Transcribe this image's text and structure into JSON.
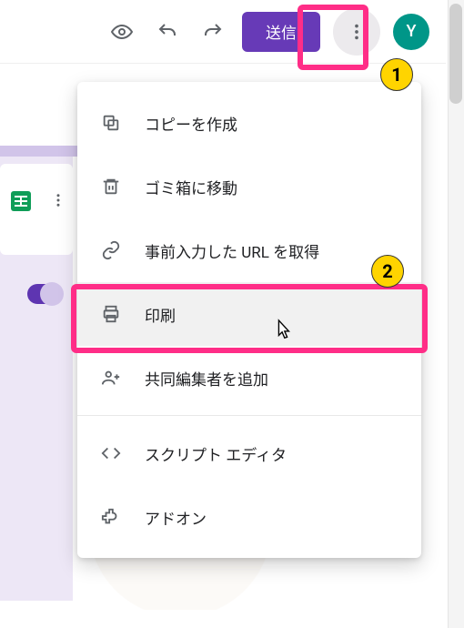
{
  "header": {
    "send_label": "送信",
    "avatar_initial": "Y"
  },
  "menu": {
    "items": [
      {
        "icon": "copy-icon",
        "label": "コピーを作成"
      },
      {
        "icon": "trash-icon",
        "label": "ゴミ箱に移動"
      },
      {
        "icon": "link-icon",
        "label": "事前入力した URL を取得"
      },
      {
        "icon": "print-icon",
        "label": "印刷"
      },
      {
        "icon": "add-collaborator-icon",
        "label": "共同編集者を追加"
      },
      {
        "icon": "script-editor-icon",
        "label": "スクリプト エディタ"
      },
      {
        "icon": "addon-icon",
        "label": "アドオン"
      }
    ]
  },
  "annotations": {
    "badge1": "1",
    "badge2": "2"
  },
  "colors": {
    "accent": "#673ab7",
    "highlight": "#ff2d87",
    "badge": "#ffd400",
    "avatar": "#009688"
  }
}
